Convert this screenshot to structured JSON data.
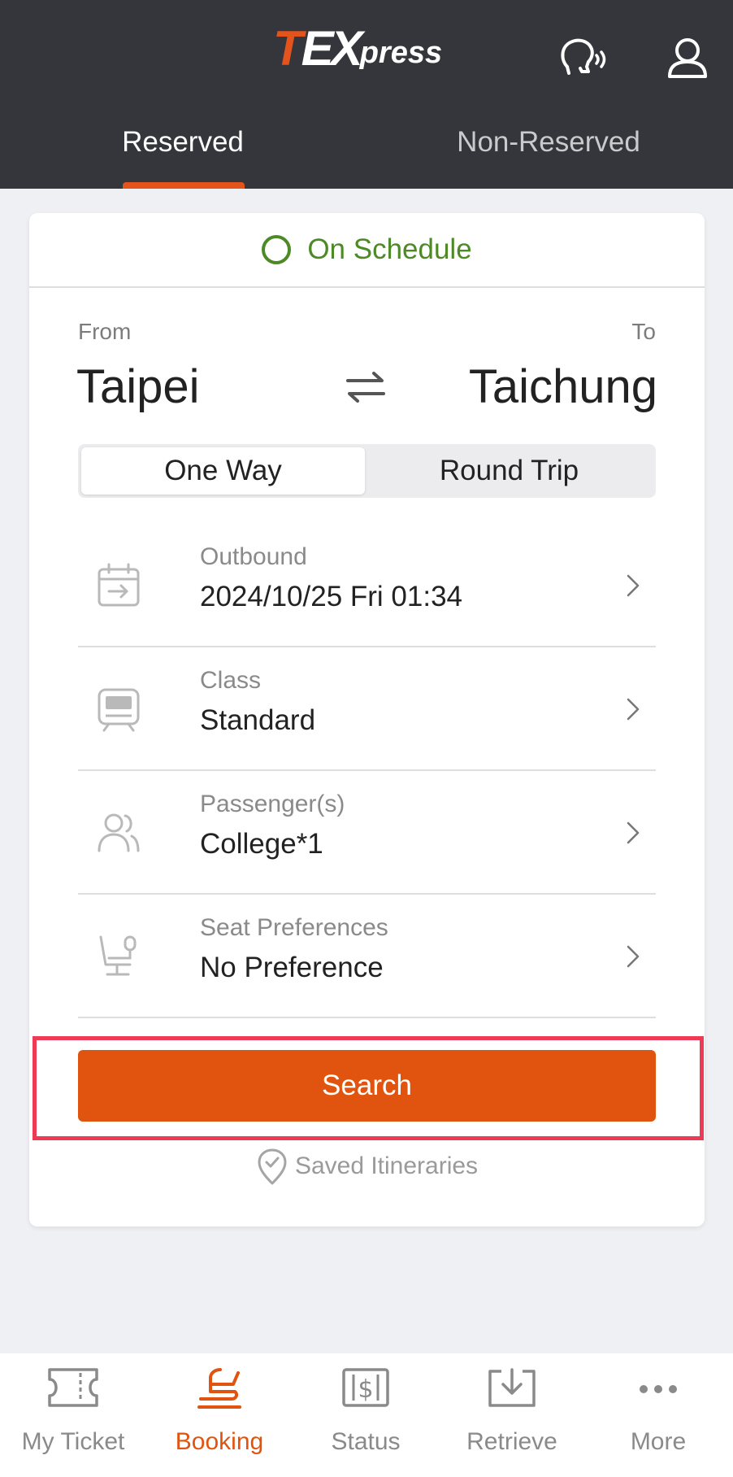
{
  "header": {
    "logo": {
      "t": "T",
      "ex": "EX",
      "press": "press"
    },
    "voice_icon": "voice-assistant-icon",
    "user_icon": "user-icon",
    "tabs": [
      {
        "label": "Reserved",
        "active": true
      },
      {
        "label": "Non-Reserved",
        "active": false
      }
    ]
  },
  "card": {
    "status": "On Schedule",
    "from_label": "From",
    "to_label": "To",
    "from_station": "Taipei",
    "to_station": "Taichung",
    "trip_types": [
      "One Way",
      "Round Trip"
    ],
    "selected_trip_type": "One Way",
    "rows": [
      {
        "label": "Outbound",
        "value": "2024/10/25 Fri 01:34",
        "icon": "calendar-icon"
      },
      {
        "label": "Class",
        "value": "Standard",
        "icon": "train-icon"
      },
      {
        "label": "Passenger(s)",
        "value": "College*1",
        "icon": "passengers-icon"
      },
      {
        "label": "Seat Preferences",
        "value": "No Preference",
        "icon": "seat-icon"
      }
    ],
    "search_label": "Search",
    "saved_label": "Saved Itineraries"
  },
  "nav": [
    {
      "label": "My Ticket",
      "icon": "ticket-icon",
      "active": false
    },
    {
      "label": "Booking",
      "icon": "seat-booking-icon",
      "active": true
    },
    {
      "label": "Status",
      "icon": "status-icon",
      "active": false
    },
    {
      "label": "Retrieve",
      "icon": "download-icon",
      "active": false
    },
    {
      "label": "More",
      "icon": "more-icon",
      "active": false
    }
  ],
  "colors": {
    "accent": "#e0540f",
    "header_bg": "#34363b",
    "status_green": "#4d8a25",
    "highlight": "#ee3a55"
  }
}
